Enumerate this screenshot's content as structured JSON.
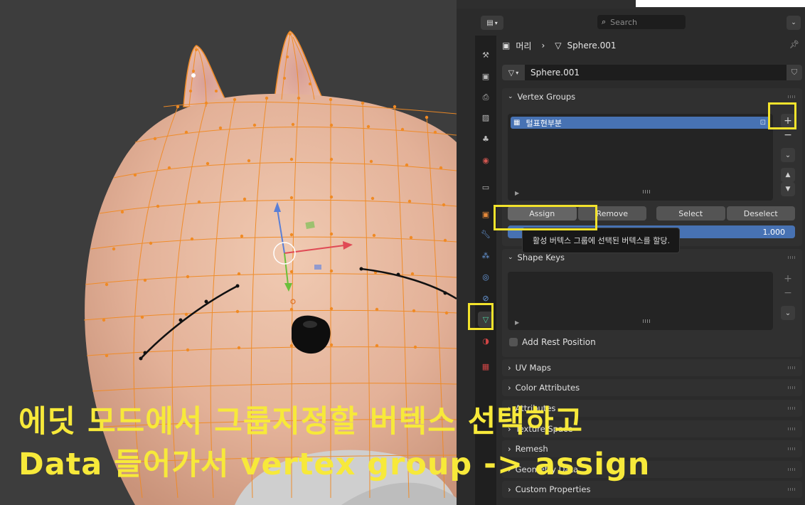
{
  "header": {
    "search_placeholder": "Search"
  },
  "breadcrumb": {
    "object_name": "머리",
    "mesh_name": "Sphere.001"
  },
  "datablock": {
    "name": "Sphere.001"
  },
  "vertex_groups": {
    "title": "Vertex Groups",
    "items": [
      {
        "label": "털표현부분"
      }
    ],
    "buttons": {
      "assign": "Assign",
      "remove": "Remove",
      "select": "Select",
      "deselect": "Deselect"
    },
    "weight_value": "1.000",
    "tooltip": "활성 버텍스 그룹에 선택된 버텍스를 할당."
  },
  "shape_keys": {
    "title": "Shape Keys",
    "add_rest_position": "Add Rest Position"
  },
  "collapsed_panels": [
    {
      "label": "UV Maps"
    },
    {
      "label": "Color Attributes"
    },
    {
      "label": "Attributes"
    },
    {
      "label": "Texture Space"
    },
    {
      "label": "Remesh"
    },
    {
      "label": "Geometry Data"
    },
    {
      "label": "Custom Properties"
    }
  ],
  "caption": {
    "line1": "에딧 모드에서 그룹지정할 버텍스 선택하고",
    "line2": "Data 들어가서 vertex group -> assign"
  },
  "colors": {
    "highlight": "#f3e32c",
    "selection_blue": "#4772b3",
    "wire_orange": "#f08a24",
    "mesh_skin": "#e8bca4"
  }
}
